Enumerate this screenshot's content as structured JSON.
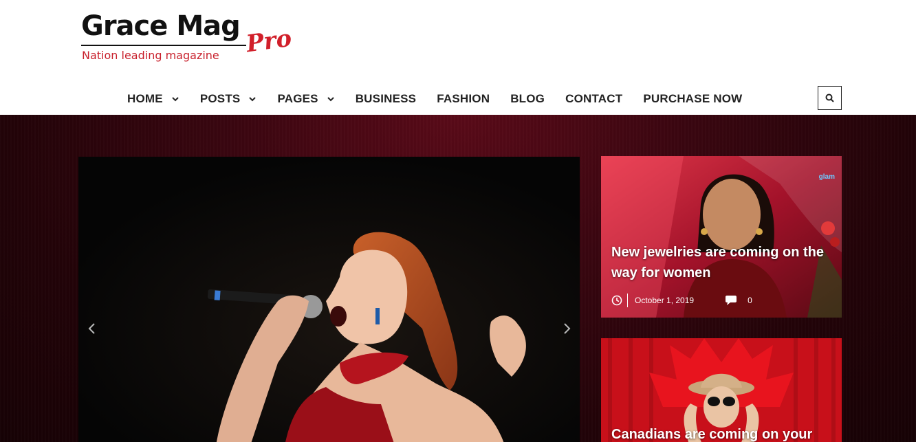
{
  "logo": {
    "title": "Grace Mag",
    "suffix": "Pro",
    "tagline": "Nation leading magazine"
  },
  "nav": {
    "items": [
      {
        "label": "HOME",
        "dropdown": true
      },
      {
        "label": "POSTS",
        "dropdown": true
      },
      {
        "label": "PAGES",
        "dropdown": true
      },
      {
        "label": "BUSINESS",
        "dropdown": false
      },
      {
        "label": "FASHION",
        "dropdown": false
      },
      {
        "label": "BLOG",
        "dropdown": false
      },
      {
        "label": "CONTACT",
        "dropdown": false
      },
      {
        "label": "PURCHASE NOW",
        "dropdown": false
      }
    ],
    "search_icon": "search-icon"
  },
  "slider": {
    "prev_icon": "chevron-left-icon",
    "next_icon": "chevron-right-icon"
  },
  "side_posts": [
    {
      "title": "New jewelries are coming on the way for women",
      "date": "October 1, 2019",
      "comments": "0",
      "clock_icon": "clock-icon",
      "comment_icon": "comment-icon"
    },
    {
      "title": "Canadians are coming on your"
    }
  ],
  "colors": {
    "brand_red": "#d11f2a",
    "hero_bg": "#3a0610",
    "nav_text": "#222222"
  }
}
